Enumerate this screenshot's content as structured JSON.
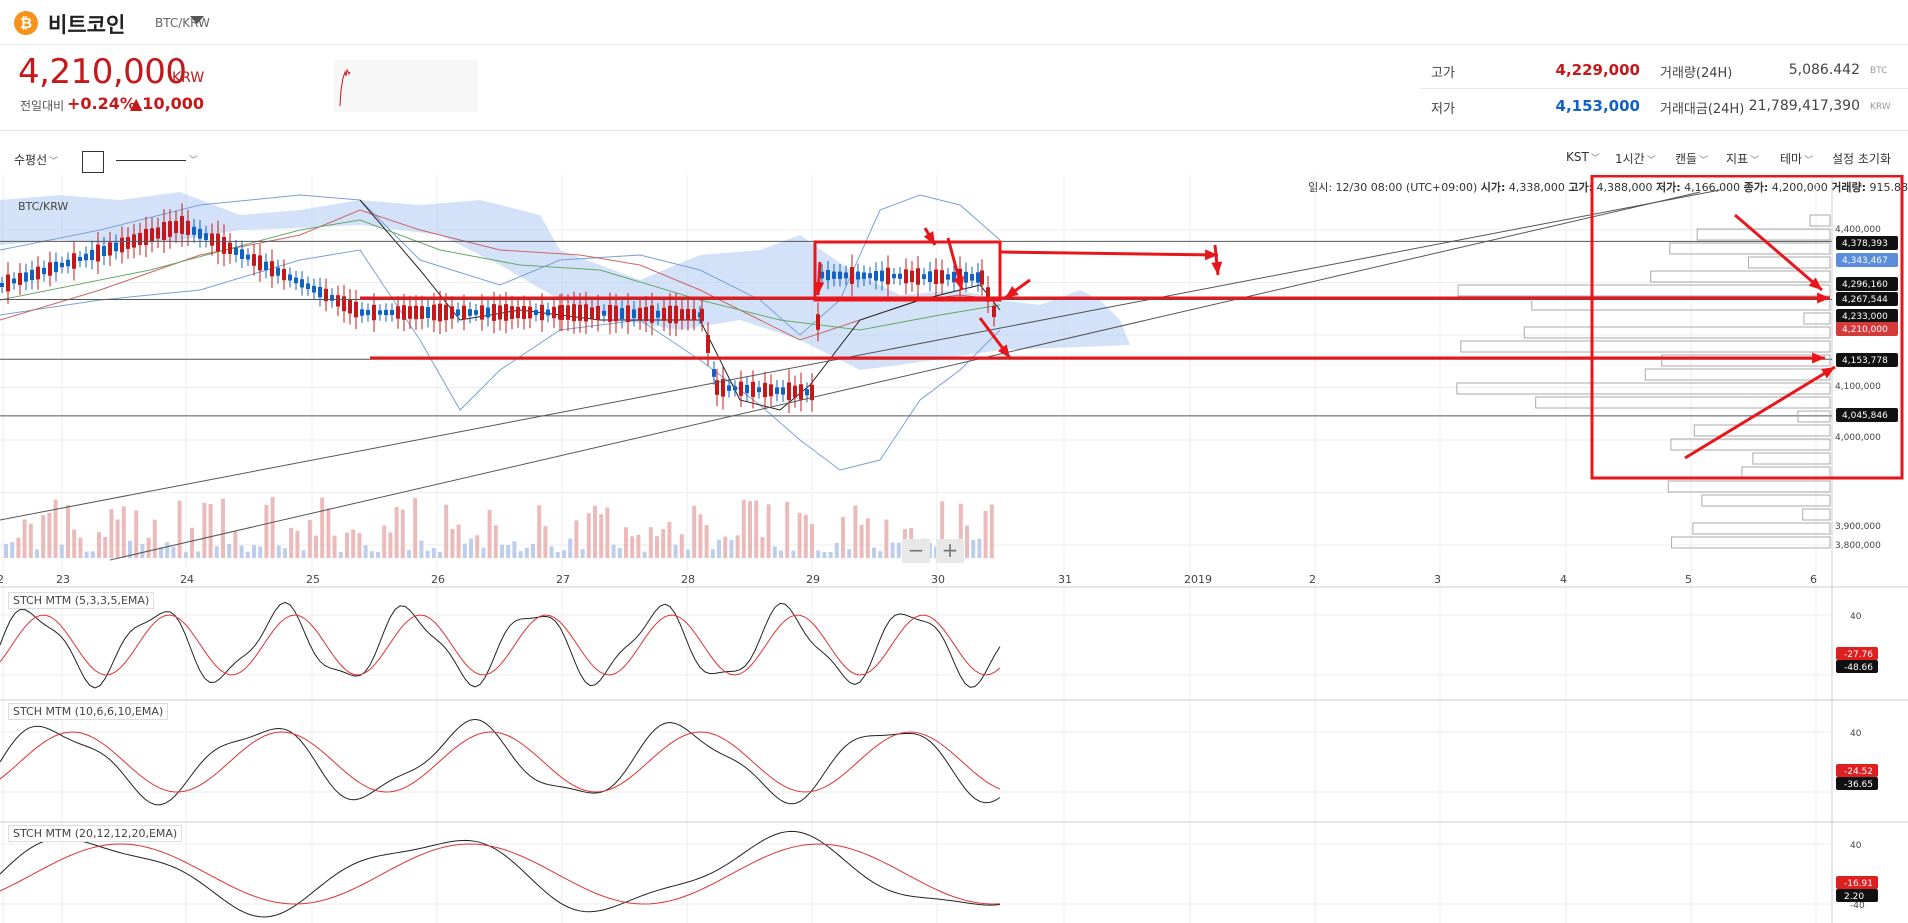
{
  "coin": {
    "name": "비트코인",
    "pair": "BTC/KRW",
    "icon": "bitcoin-icon"
  },
  "ticker": {
    "price": "4,210,000",
    "unit": "KRW",
    "change_label": "전일대비",
    "change_pct": "+0.24%",
    "change_abs": "▲10,000"
  },
  "stats": {
    "high_label": "고가",
    "high": "4,229,000",
    "low_label": "저가",
    "low": "4,153,000",
    "volume_label": "거래량(24H)",
    "volume": "5,086.442",
    "volume_unit": "BTC",
    "amount_label": "거래대금(24H)",
    "amount": "21,789,417,390",
    "amount_unit": "KRW"
  },
  "toolbar": {
    "draw_tool": "수평선",
    "tz": "KST",
    "interval": "1시간",
    "chart_type": "캔들",
    "indicators": "지표",
    "theme": "테마",
    "reset": "설정 초기화"
  },
  "ohlc": {
    "time_label": "일시:",
    "time": "12/30 08:00 (UTC+09:00)",
    "open_label": "시가:",
    "open": "4,338,000",
    "high_label": "고가:",
    "high": "4,388,000",
    "low_label": "저가:",
    "low": "4,166,000",
    "close_label": "종가:",
    "close": "4,200,000",
    "vol_label": "거래량:",
    "vol": "915.88"
  },
  "chart_data": {
    "type": "candlestick",
    "pair": "BTC/KRW",
    "interval": "1시간",
    "x_ticks": [
      "2",
      "23",
      "24",
      "25",
      "26",
      "27",
      "28",
      "29",
      "30",
      "31",
      "2019",
      "2",
      "3",
      "4",
      "5",
      "6"
    ],
    "y_ticks": [
      "4,400,000",
      "4,300,000",
      "4,200,000",
      "4,100,000",
      "4,000,000",
      "3,900,000",
      "3,800,000"
    ],
    "ylim": [
      3770000,
      4430000
    ],
    "price_tags": [
      {
        "value": "4,378,393",
        "color": "#111111"
      },
      {
        "value": "4,343,467",
        "color": "#5b8ddb"
      },
      {
        "value": "4,296,160",
        "color": "#111111"
      },
      {
        "value": "4,267,544",
        "color": "#111111"
      },
      {
        "value": "4,233,000",
        "color": "#111111"
      },
      {
        "value": "4,210,000",
        "color": "#d33b3b"
      },
      {
        "value": "4,153,778",
        "color": "#111111"
      },
      {
        "value": "4,045,846",
        "color": "#111111"
      }
    ],
    "horizontal_lines": [
      4378393,
      4267544,
      4153778,
      4045846
    ],
    "series": [
      {
        "name": "close",
        "x": [
          "23",
          "24",
          "25",
          "26",
          "27",
          "28",
          "29",
          "30"
        ],
        "values": [
          4310000,
          4390000,
          4190000,
          4170000,
          4210000,
          4080000,
          4310000,
          4210000
        ]
      }
    ],
    "indicators": [
      {
        "name": "STCH MTM (5,3,3,5,EMA)",
        "tags": [
          "-27.76",
          "-48.66"
        ],
        "tick": "40"
      },
      {
        "name": "STCH MTM (10,6,6,10,EMA)",
        "tags": [
          "-24.52",
          "-36.65"
        ],
        "tick": "40"
      },
      {
        "name": "STCH MTM (20,12,12,20,EMA)",
        "tags": [
          "-16.91",
          "2.20"
        ],
        "ticks": [
          "40",
          "-40"
        ]
      }
    ]
  },
  "colors": {
    "up": "#c5181b",
    "down": "#1261c4",
    "annotation": "#e8161b",
    "cloud": "#aecbf2"
  }
}
